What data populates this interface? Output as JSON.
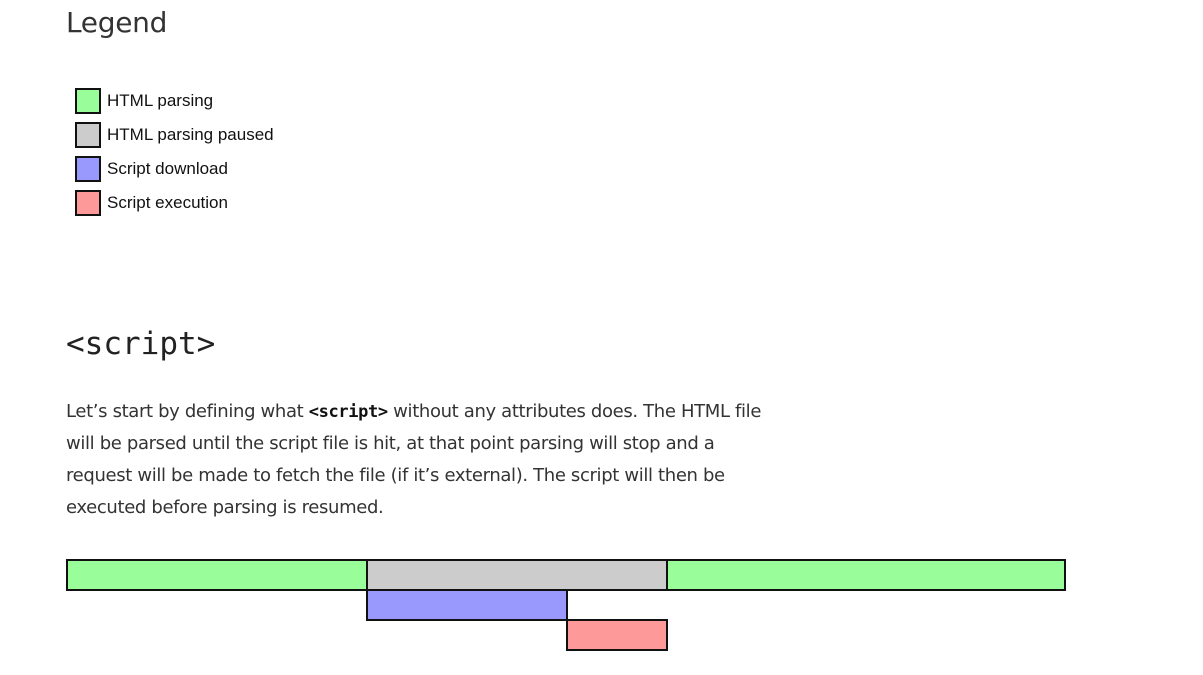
{
  "legend": {
    "title": "Legend",
    "items": [
      {
        "key": "html-parsing",
        "label": "HTML parsing",
        "color": "#99fd99"
      },
      {
        "key": "html-parsing-paused",
        "label": "HTML parsing paused",
        "color": "#cccccc"
      },
      {
        "key": "script-download",
        "label": "Script download",
        "color": "#9999fd"
      },
      {
        "key": "script-execution",
        "label": "Script execution",
        "color": "#fd9999"
      }
    ]
  },
  "section": {
    "title": "<script>",
    "paragraph": {
      "part1": "Let’s start by defining what ",
      "code": "<script>",
      "part2": " without any attributes does. The HTML file will be parsed until the script file is hit, at that point parsing will stop and a request will be made to fetch the file (if it’s external). The script will then be executed before parsing is resumed."
    }
  },
  "timeline": {
    "rows": [
      [
        {
          "kind": "html-parsing",
          "start": 0,
          "end": 3
        },
        {
          "kind": "html-parsing-paused",
          "start": 3,
          "end": 6
        },
        {
          "kind": "html-parsing",
          "start": 6,
          "end": 10
        }
      ],
      [
        {
          "kind": "script-download",
          "start": 3,
          "end": 5
        }
      ],
      [
        {
          "kind": "script-execution",
          "start": 5,
          "end": 6
        }
      ]
    ]
  }
}
